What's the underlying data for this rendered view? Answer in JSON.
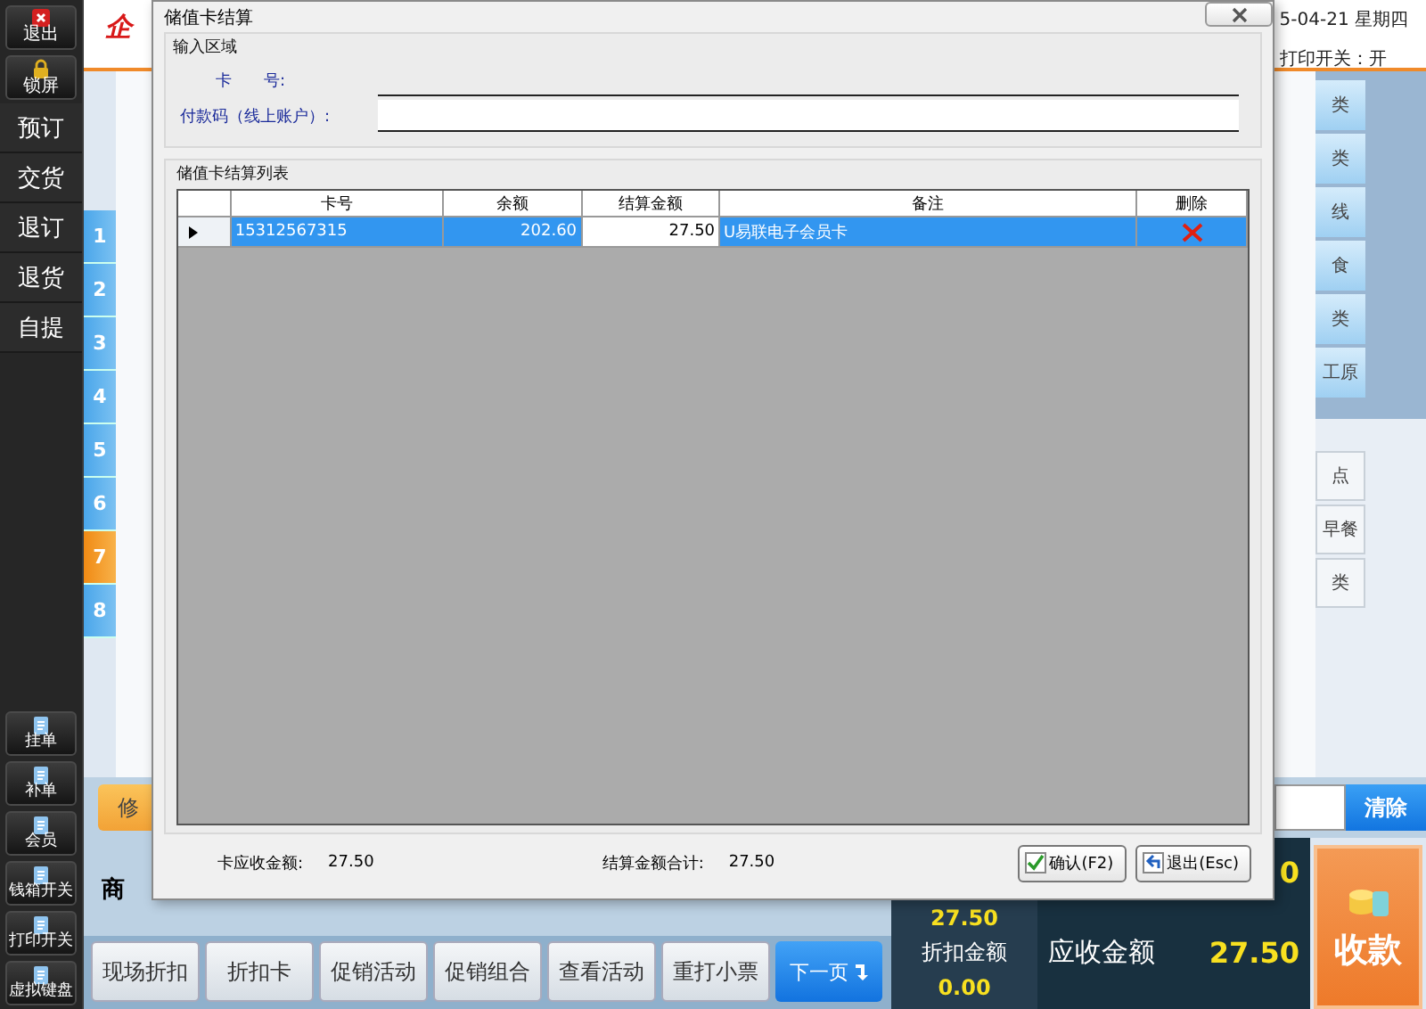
{
  "app": {
    "logo": "企",
    "date": "5-04-21 星期四",
    "print_status": "打印开关：开",
    "sidebar_top": [
      "退出",
      "锁屏"
    ],
    "sidebar_menu": [
      "预订",
      "交货",
      "退订",
      "退货",
      "自提"
    ],
    "sidebar_bottom": [
      "挂单",
      "补单",
      "会员",
      "钱箱开关",
      "打印开关",
      "虚拟键盘"
    ],
    "number_tabs": [
      {
        "label": "1",
        "selected": false
      },
      {
        "label": "2",
        "selected": false
      },
      {
        "label": "3",
        "selected": false
      },
      {
        "label": "4",
        "selected": false
      },
      {
        "label": "5",
        "selected": false
      },
      {
        "label": "6",
        "selected": false
      },
      {
        "label": "7",
        "selected": true
      },
      {
        "label": "8",
        "selected": false
      }
    ],
    "category_buttons": [
      "类",
      "类",
      "线",
      "食",
      "类",
      "工原"
    ],
    "category_buttons_2": [
      "点",
      "早餐",
      "类"
    ],
    "edit_button": "修",
    "clear_button": "清除",
    "goods_label": "商",
    "toolbar": [
      "现场折扣",
      "折扣卡",
      "促销活动",
      "促销组合",
      "查看活动",
      "重打小票"
    ],
    "next_page": "下一页",
    "summary": {
      "amount": "27.50",
      "discount_label": "折扣金额",
      "discount": "0.00",
      "due_label": "应收金额",
      "due": "27.50",
      "total": "0"
    },
    "pay_button": "收款"
  },
  "dialog": {
    "title": "储值卡结算",
    "input_group": {
      "title": "输入区域",
      "fields": [
        {
          "label": "卡　　号:"
        },
        {
          "label": "付款码（线上账户）:"
        }
      ]
    },
    "list_group": {
      "title": "储值卡结算列表",
      "columns": [
        "卡号",
        "余额",
        "结算金额",
        "备注",
        "删除"
      ],
      "rows": [
        {
          "selected": true,
          "card": "15312567315",
          "balance": "202.60",
          "amount": "27.50",
          "note": "U易联电子会员卡"
        }
      ]
    },
    "footer": {
      "due_label": "卡应收金额:",
      "due": "27.50",
      "total_label": "结算金额合计:",
      "total": "27.50"
    },
    "buttons": [
      "确认(F2)",
      "退出(Esc)"
    ]
  }
}
